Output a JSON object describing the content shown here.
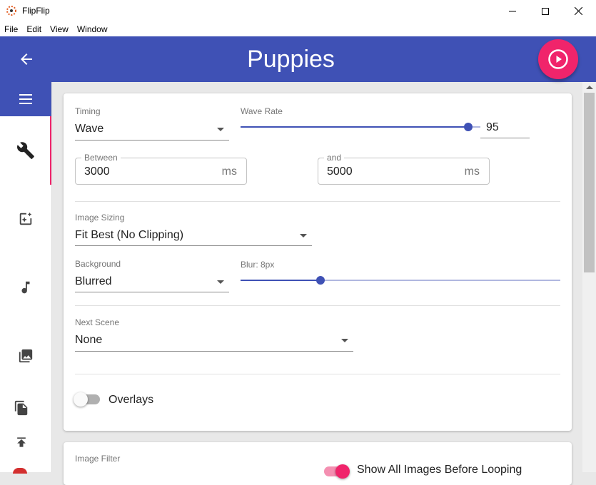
{
  "window": {
    "title": "FlipFlip"
  },
  "menu": [
    "File",
    "Edit",
    "View",
    "Window"
  ],
  "header": {
    "scene_title": "Puppies"
  },
  "colors": {
    "primary": "#3f51b5",
    "accent": "#f0246b"
  },
  "sidebar": {
    "icons": [
      "menu-icon",
      "wrench-icon",
      "add-photo-icon",
      "music-note-icon",
      "image-library-icon",
      "copy-icon",
      "export-icon"
    ]
  },
  "timing": {
    "label": "Timing",
    "value": "Wave",
    "wave_rate_label": "Wave Rate",
    "wave_rate_value": "95",
    "wave_rate_fraction": 0.95,
    "between_label": "Between",
    "between_value": "3000",
    "between_unit": "ms",
    "and_label": "and",
    "and_value": "5000",
    "and_unit": "ms"
  },
  "image_sizing": {
    "label": "Image Sizing",
    "value": "Fit Best (No Clipping)"
  },
  "background": {
    "label": "Background",
    "value": "Blurred",
    "blur_label": "Blur: 8px",
    "blur_fraction": 0.25
  },
  "next_scene": {
    "label": "Next Scene",
    "value": "None"
  },
  "overlays": {
    "label": "Overlays",
    "enabled": false
  },
  "card2": {
    "image_filter_label": "Image Filter",
    "show_all_label": "Show All Images Before Looping"
  }
}
